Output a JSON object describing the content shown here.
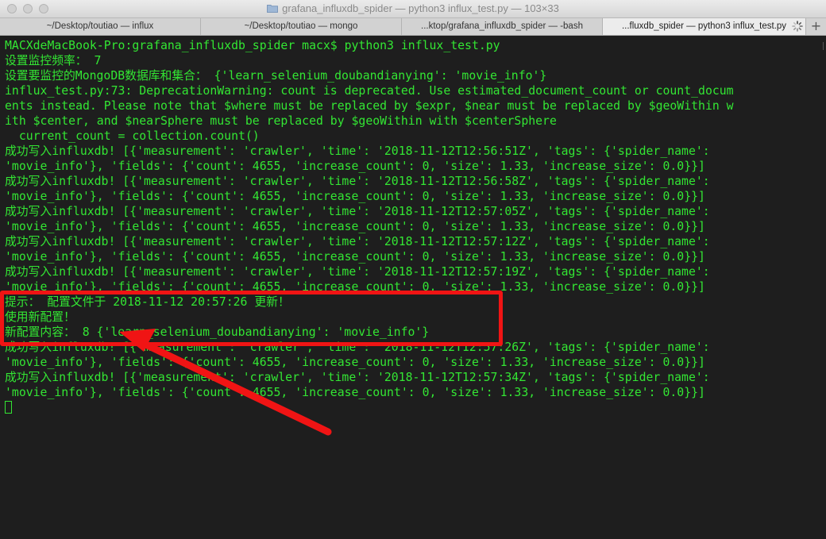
{
  "window": {
    "title": "grafana_influxdb_spider — python3 influx_test.py — 103×33"
  },
  "tabs": [
    {
      "label": "~/Desktop/toutiao — influx"
    },
    {
      "label": "~/Desktop/toutiao — mongo"
    },
    {
      "label": "...ktop/grafana_influxdb_spider — -bash"
    },
    {
      "label": "...fluxdb_spider — python3 influx_test.py",
      "active": true
    }
  ],
  "new_tab_label": "+",
  "terminal": {
    "lines": [
      "MACXdeMacBook-Pro:grafana_influxdb_spider macx$ python3 influx_test.py",
      "设置监控频率： 7",
      "设置要监控的MongoDB数据库和集合： {'learn_selenium_doubandianying': 'movie_info'}",
      "influx_test.py:73: DeprecationWarning: count is deprecated. Use estimated_document_count or count_docum",
      "ents instead. Please note that $where must be replaced by $expr, $near must be replaced by $geoWithin w",
      "ith $center, and $nearSphere must be replaced by $geoWithin with $centerSphere",
      "  current_count = collection.count()",
      "成功写入influxdb! [{'measurement': 'crawler', 'time': '2018-11-12T12:56:51Z', 'tags': {'spider_name':",
      "'movie_info'}, 'fields': {'count': 4655, 'increase_count': 0, 'size': 1.33, 'increase_size': 0.0}}]",
      "成功写入influxdb! [{'measurement': 'crawler', 'time': '2018-11-12T12:56:58Z', 'tags': {'spider_name':",
      "'movie_info'}, 'fields': {'count': 4655, 'increase_count': 0, 'size': 1.33, 'increase_size': 0.0}}]",
      "成功写入influxdb! [{'measurement': 'crawler', 'time': '2018-11-12T12:57:05Z', 'tags': {'spider_name':",
      "'movie_info'}, 'fields': {'count': 4655, 'increase_count': 0, 'size': 1.33, 'increase_size': 0.0}}]",
      "成功写入influxdb! [{'measurement': 'crawler', 'time': '2018-11-12T12:57:12Z', 'tags': {'spider_name':",
      "'movie_info'}, 'fields': {'count': 4655, 'increase_count': 0, 'size': 1.33, 'increase_size': 0.0}}]",
      "成功写入influxdb! [{'measurement': 'crawler', 'time': '2018-11-12T12:57:19Z', 'tags': {'spider_name':",
      "'movie_info'}, 'fields': {'count': 4655, 'increase_count': 0, 'size': 1.33, 'increase_size': 0.0}}]",
      "提示： 配置文件于 2018-11-12 20:57:26 更新！",
      "使用新配置！",
      "新配置内容： 8 {'learn_selenium_doubandianying': 'movie_info'}",
      "成功写入influxdb! [{'measurement': 'crawler', 'time': '2018-11-12T12:57:26Z', 'tags': {'spider_name':",
      "'movie_info'}, 'fields': {'count': 4655, 'increase_count': 0, 'size': 1.33, 'increase_size': 0.0}}]",
      "成功写入influxdb! [{'measurement': 'crawler', 'time': '2018-11-12T12:57:34Z', 'tags': {'spider_name':",
      "'movie_info'}, 'fields': {'count': 4655, 'increase_count': 0, 'size': 1.33, 'increase_size': 0.0}}]",
      ""
    ]
  },
  "colors": {
    "terminal_bg": "#1e1e1e",
    "terminal_text": "#33e633",
    "annotation_red": "#f01414"
  },
  "icons": {
    "title_folder": "folder-icon",
    "tab_spinner": "spinner-icon"
  }
}
